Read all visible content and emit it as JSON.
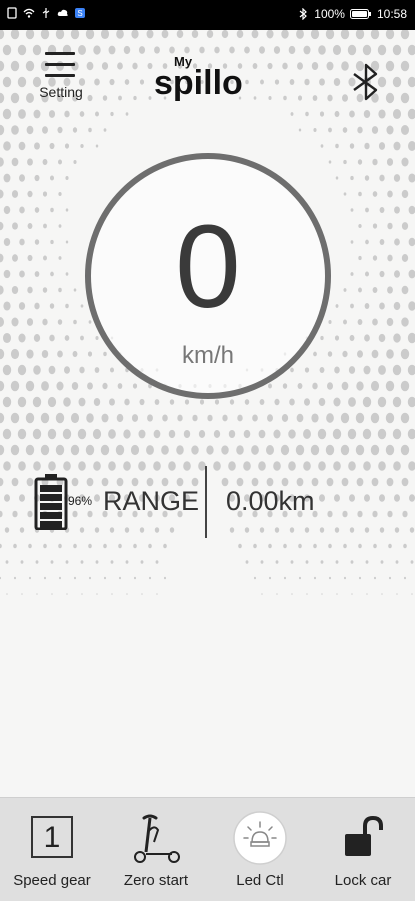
{
  "status_bar": {
    "battery_percent": "100%",
    "time": "10:58",
    "icons": [
      "sim-icon",
      "wifi-icon",
      "usb-icon",
      "cloud-icon",
      "app-notification-icon",
      "bluetooth-icon",
      "battery-icon"
    ]
  },
  "header": {
    "menu_label": "Setting",
    "logo_small": "My",
    "logo_main": "spillo",
    "bluetooth_icon": "bluetooth-icon"
  },
  "speedometer": {
    "speed": "0",
    "unit": "km/h"
  },
  "info": {
    "battery_percent": "96%",
    "battery_level": 0.96,
    "range_label": "RANGE",
    "range_value": "0.00km"
  },
  "bottom_bar": {
    "items": [
      {
        "label": "Speed gear",
        "value": "1",
        "icon": "speed-gear-icon"
      },
      {
        "label": "Zero start",
        "icon": "scooter-icon"
      },
      {
        "label": "Led Ctl",
        "icon": "light-bulb-icon"
      },
      {
        "label": "Lock car",
        "icon": "padlock-open-icon"
      }
    ]
  },
  "colors": {
    "background": "#f6f6f5",
    "gauge_ring": "#6e6e6e",
    "bottom_bar": "#dfdfdf"
  }
}
